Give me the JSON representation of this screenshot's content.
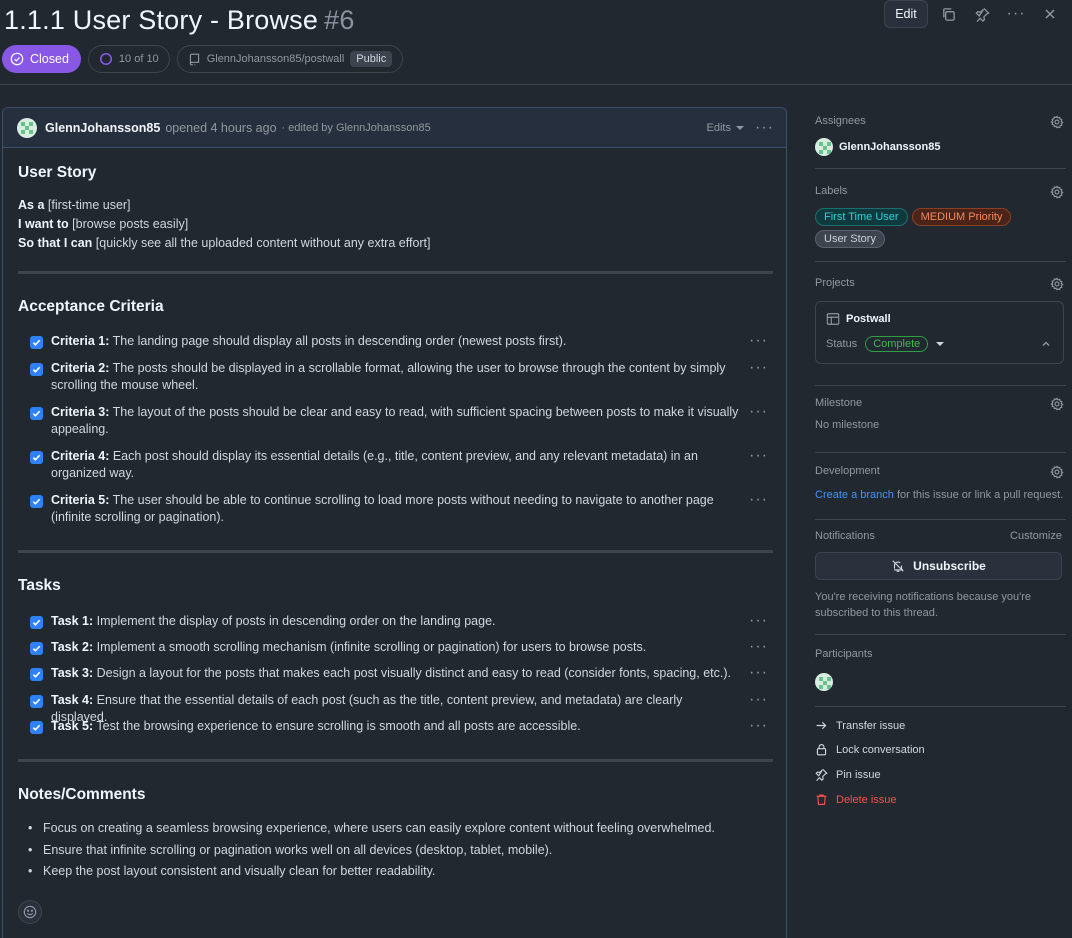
{
  "issue": {
    "title": "1.1.1 User Story - Browse",
    "number": "#6",
    "state": "Closed",
    "progress": "10 of 10",
    "repo": "GlennJohansson85/postwall",
    "visibility": "Public"
  },
  "toolbar": {
    "edit_label": "Edit"
  },
  "comment": {
    "author": "GlennJohansson85",
    "opened": "opened 4 hours ago",
    "edited": "· edited by GlennJohansson85",
    "edits_label": "Edits",
    "story_heading": "User Story",
    "story": [
      {
        "bold": "As a",
        "text": " [first-time user]"
      },
      {
        "bold": "I want to",
        "text": " [browse posts easily]"
      },
      {
        "bold": "So that I can",
        "text": " [quickly see all the uploaded content without any extra effort]"
      }
    ],
    "criteria_heading": "Acceptance Criteria",
    "criteria": [
      {
        "bold": "Criteria 1:",
        "text": " The landing page should display all posts in descending order (newest posts first)."
      },
      {
        "bold": "Criteria 2:",
        "text": " The posts should be displayed in a scrollable format, allowing the user to browse through the content by simply scrolling the mouse wheel."
      },
      {
        "bold": "Criteria 3:",
        "text": " The layout of the posts should be clear and easy to read, with sufficient spacing between posts to make it visually appealing."
      },
      {
        "bold": "Criteria 4:",
        "text": " Each post should display its essential details (e.g., title, content preview, and any relevant metadata) in an organized way."
      },
      {
        "bold": "Criteria 5:",
        "text": " The user should be able to continue scrolling to load more posts without needing to navigate to another page (infinite scrolling or pagination)."
      }
    ],
    "tasks_heading": "Tasks",
    "tasks": [
      {
        "bold": "Task 1:",
        "text": " Implement the display of posts in descending order on the landing page."
      },
      {
        "bold": "Task 2:",
        "text": " Implement a smooth scrolling mechanism (infinite scrolling or pagination) for users to browse posts."
      },
      {
        "bold": "Task 3:",
        "text": " Design a layout for the posts that makes each post visually distinct and easy to read (consider fonts, spacing, etc.)."
      },
      {
        "bold": "Task 4:",
        "text": " Ensure that the essential details of each post (such as the title, content preview, and metadata) are clearly displayed."
      },
      {
        "bold": "Task 5:",
        "text": " Test the browsing experience to ensure scrolling is smooth and all posts are accessible."
      }
    ],
    "notes_heading": "Notes/Comments",
    "notes": [
      "Focus on creating a seamless browsing experience, where users can easily explore content without feeling overwhelmed.",
      "Ensure that infinite scrolling or pagination works well on all devices (desktop, tablet, mobile).",
      "Keep the post layout consistent and visually clean for better readability."
    ]
  },
  "sidebar": {
    "assignees_title": "Assignees",
    "assignee": "GlennJohansson85",
    "labels_title": "Labels",
    "labels": [
      {
        "name": "First Time User",
        "color": "#2dd4da",
        "bg": "#0e3a3d"
      },
      {
        "name": "MEDIUM Priority",
        "color": "#f08a5d",
        "bg": "#4a2418"
      },
      {
        "name": "User Story",
        "color": "#c9d1d9",
        "bg": "#3d444d"
      }
    ],
    "projects_title": "Projects",
    "project_name": "Postwall",
    "status_label": "Status",
    "status_value": "Complete",
    "milestone_title": "Milestone",
    "milestone_value": "No milestone",
    "development_title": "Development",
    "dev_link": "Create a branch",
    "dev_text": " for this issue or link a pull request.",
    "notifications_title": "Notifications",
    "customize": "Customize",
    "unsubscribe": "Unsubscribe",
    "notif_text": "You're receiving notifications because you're subscribed to this thread.",
    "participants_title": "Participants",
    "actions": [
      {
        "label": "Transfer issue",
        "icon": "arrow-right-icon"
      },
      {
        "label": "Lock conversation",
        "icon": "lock-icon"
      },
      {
        "label": "Pin issue",
        "icon": "pin-icon"
      },
      {
        "label": "Delete issue",
        "icon": "trash-icon"
      }
    ]
  },
  "colors": {
    "closed": "#8957e5",
    "checkbox": "#2f81f7",
    "link": "#4493f8",
    "danger": "#f85149",
    "success": "#3fb950"
  }
}
